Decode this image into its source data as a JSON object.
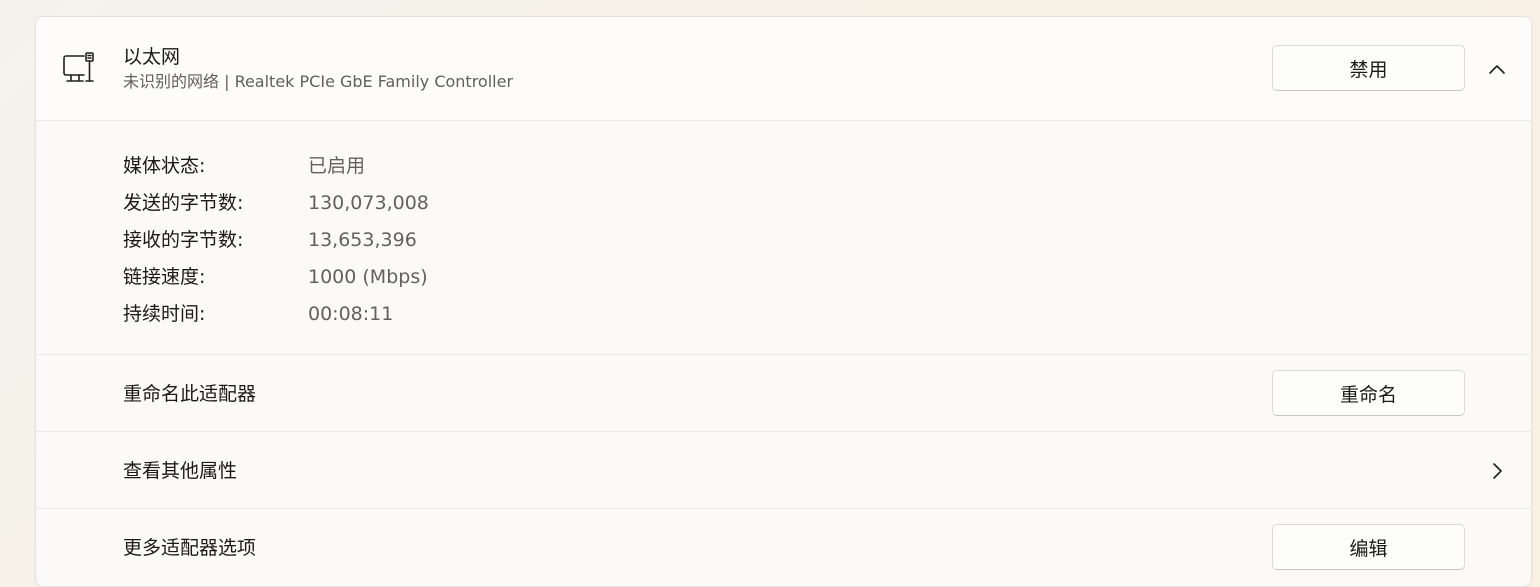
{
  "adapter": {
    "name": "以太网",
    "description": "未识别的网络 | Realtek PCIe GbE Family Controller",
    "icon": "wired-network-adapter-icon",
    "disable_label": "禁用",
    "collapse_icon": "chevron-up-icon"
  },
  "properties": [
    {
      "label": "媒体状态:",
      "value": "已启用"
    },
    {
      "label": "发送的字节数:",
      "value": "130,073,008"
    },
    {
      "label": "接收的字节数:",
      "value": "13,653,396"
    },
    {
      "label": "链接速度:",
      "value": "1000 (Mbps)"
    },
    {
      "label": "持续时间:",
      "value": "00:08:11"
    }
  ],
  "rename": {
    "label": "重命名此适配器",
    "button_label": "重命名"
  },
  "more_properties": {
    "label": "查看其他属性",
    "icon": "chevron-right-icon"
  },
  "more_options": {
    "label": "更多适配器选项",
    "button_label": "编辑"
  },
  "colors": {
    "panel_background": "#fcfbf9",
    "divider": "#ebe9e6",
    "secondary_text": "#5f5f5f"
  }
}
